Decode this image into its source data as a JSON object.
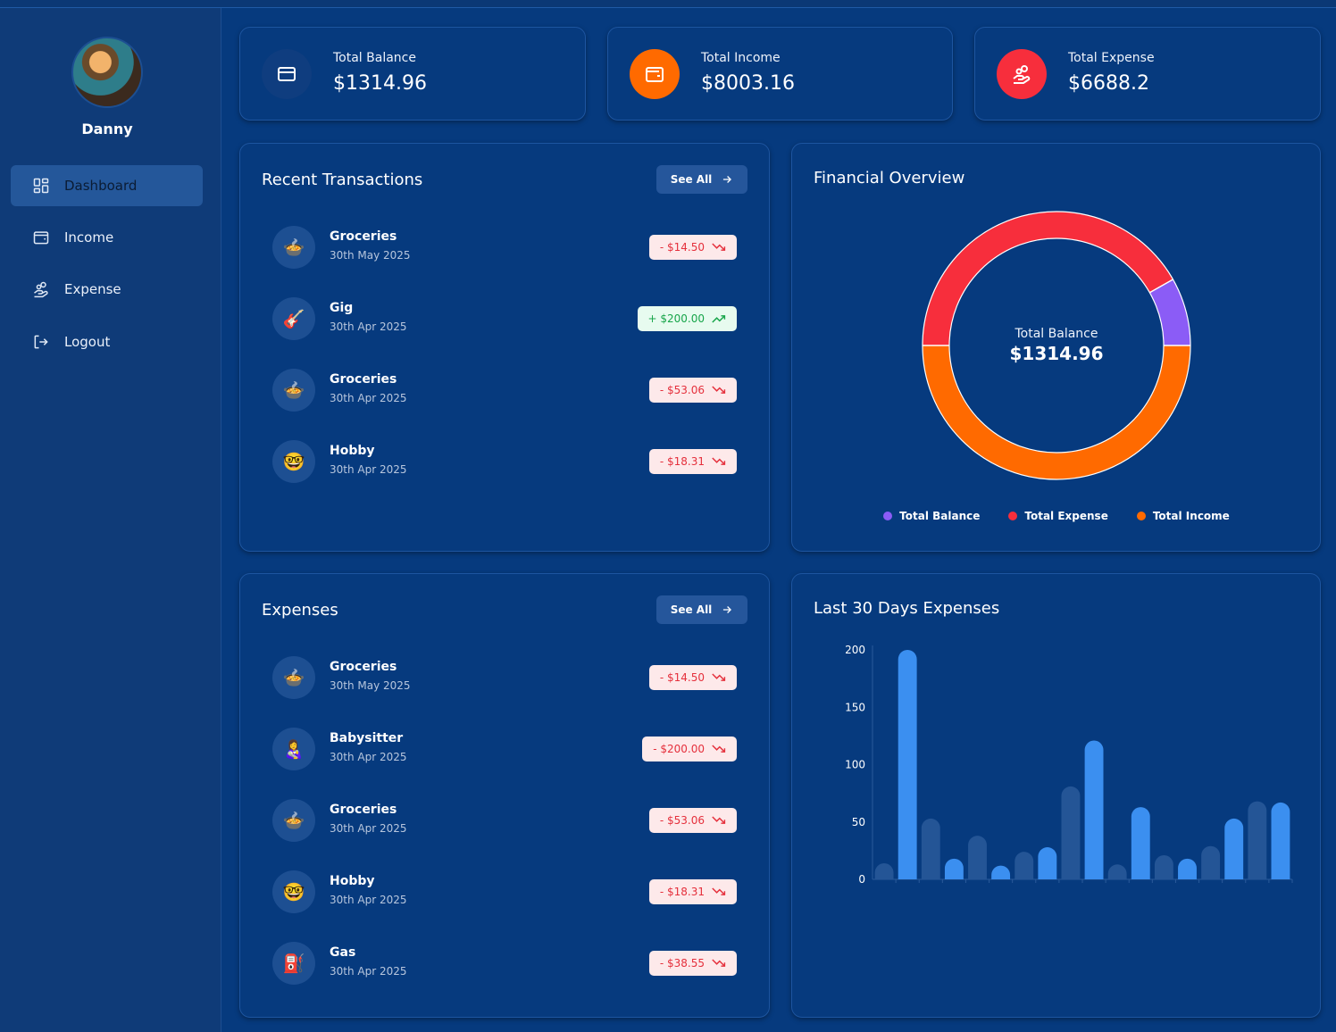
{
  "user": {
    "name": "Danny"
  },
  "nav": [
    {
      "label": "Dashboard",
      "icon": "dashboard-icon",
      "active": true
    },
    {
      "label": "Income",
      "icon": "wallet-icon",
      "active": false
    },
    {
      "label": "Expense",
      "icon": "hand-coins-icon",
      "active": false
    },
    {
      "label": "Logout",
      "icon": "logout-icon",
      "active": false
    }
  ],
  "stats": [
    {
      "label": "Total Balance",
      "value": "$1314.96",
      "icon": "credit-card-icon",
      "color": "#0f3d7f"
    },
    {
      "label": "Total Income",
      "value": "$8003.16",
      "icon": "wallet-icon",
      "color": "#ff6a00"
    },
    {
      "label": "Total Expense",
      "value": "$6688.2",
      "icon": "hand-coins-icon",
      "color": "#f72e3c"
    }
  ],
  "recent": {
    "title": "Recent Transactions",
    "see_all": "See All",
    "items": [
      {
        "emoji": "🍲",
        "name": "Groceries",
        "date": "30th May 2025",
        "amount": "- $14.50",
        "type": "neg"
      },
      {
        "emoji": "🎸",
        "name": "Gig",
        "date": "30th Apr 2025",
        "amount": "+ $200.00",
        "type": "pos"
      },
      {
        "emoji": "🍲",
        "name": "Groceries",
        "date": "30th Apr 2025",
        "amount": "- $53.06",
        "type": "neg"
      },
      {
        "emoji": "🤓",
        "name": "Hobby",
        "date": "30th Apr 2025",
        "amount": "- $18.31",
        "type": "neg"
      }
    ]
  },
  "overview": {
    "title": "Financial Overview",
    "center_label": "Total Balance",
    "center_value": "$1314.96",
    "segments": [
      {
        "name": "Total Balance",
        "value": 1314.96,
        "color": "#8b5cf6"
      },
      {
        "name": "Total Expense",
        "value": 6688.2,
        "color": "#f72e3c"
      },
      {
        "name": "Total Income",
        "value": 8003.16,
        "color": "#ff6a00"
      }
    ]
  },
  "expenses": {
    "title": "Expenses",
    "see_all": "See All",
    "items": [
      {
        "emoji": "🍲",
        "name": "Groceries",
        "date": "30th May 2025",
        "amount": "- $14.50",
        "type": "neg"
      },
      {
        "emoji": "👩‍🍼",
        "name": "Babysitter",
        "date": "30th Apr 2025",
        "amount": "- $200.00",
        "type": "neg"
      },
      {
        "emoji": "🍲",
        "name": "Groceries",
        "date": "30th Apr 2025",
        "amount": "- $53.06",
        "type": "neg"
      },
      {
        "emoji": "🤓",
        "name": "Hobby",
        "date": "30th Apr 2025",
        "amount": "- $18.31",
        "type": "neg"
      },
      {
        "emoji": "⛽",
        "name": "Gas",
        "date": "30th Apr 2025",
        "amount": "- $38.55",
        "type": "neg"
      }
    ]
  },
  "chart_data": {
    "type": "bar",
    "title": "Last 30 Days Expenses",
    "ylim": [
      0,
      200
    ],
    "yticks": [
      0,
      50,
      100,
      150,
      200
    ],
    "values": [
      14,
      200,
      53,
      18,
      38,
      12,
      24,
      28,
      81,
      121,
      13,
      63,
      21,
      18,
      29,
      53,
      68,
      67
    ],
    "colors": {
      "light": "#3b8ff0",
      "dark": "#245596"
    }
  }
}
